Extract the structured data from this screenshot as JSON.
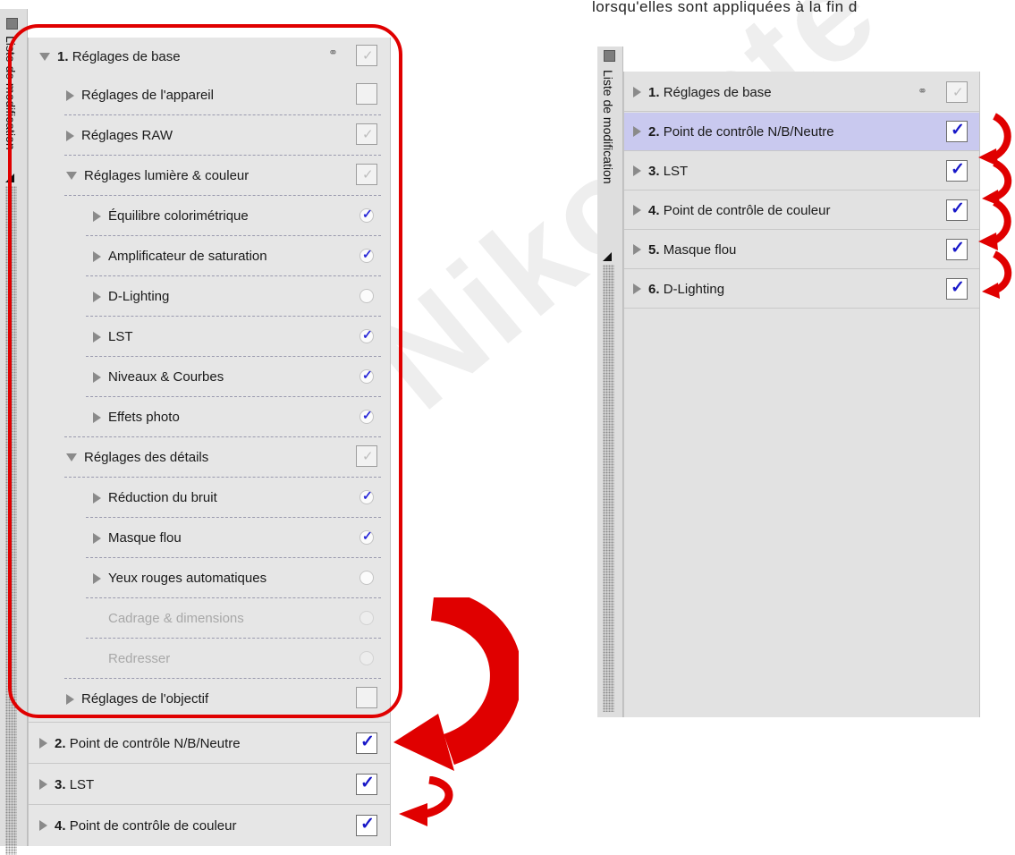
{
  "top_text": "lorsqu'elles  sont  appliquées  à  la  fin  d",
  "watermark": "Nikoliste",
  "left_panel": {
    "side_label": "Liste de modification",
    "header": {
      "number": "1.",
      "label": "Réglages de base"
    },
    "items": [
      {
        "label": "Réglages de l'appareil",
        "indent": 1,
        "expanded": false,
        "control": "checkbox-empty"
      },
      {
        "label": "Réglages RAW",
        "indent": 1,
        "expanded": false,
        "control": "checkbox-grey"
      },
      {
        "label": "Réglages lumière & couleur",
        "indent": 1,
        "expanded": true,
        "control": "checkbox-grey"
      },
      {
        "label": "Équilibre colorimétrique",
        "indent": 2,
        "expanded": false,
        "control": "radio-checked"
      },
      {
        "label": "Amplificateur de saturation",
        "indent": 2,
        "expanded": false,
        "control": "radio-checked"
      },
      {
        "label": "D-Lighting",
        "indent": 2,
        "expanded": false,
        "control": "radio-empty"
      },
      {
        "label": "LST",
        "indent": 2,
        "expanded": false,
        "control": "radio-checked"
      },
      {
        "label": "Niveaux & Courbes",
        "indent": 2,
        "expanded": false,
        "control": "radio-checked"
      },
      {
        "label": "Effets photo",
        "indent": 2,
        "expanded": false,
        "control": "radio-checked"
      },
      {
        "label": "Réglages des détails",
        "indent": 1,
        "expanded": true,
        "control": "checkbox-grey"
      },
      {
        "label": "Réduction du bruit",
        "indent": 2,
        "expanded": false,
        "control": "radio-checked"
      },
      {
        "label": "Masque flou",
        "indent": 2,
        "expanded": false,
        "control": "radio-checked"
      },
      {
        "label": "Yeux rouges automatiques",
        "indent": 2,
        "expanded": false,
        "control": "radio-empty"
      },
      {
        "label": "Cadrage & dimensions",
        "indent": 2,
        "disabled": true,
        "control": "radio-dim"
      },
      {
        "label": "Redresser",
        "indent": 2,
        "disabled": true,
        "control": "radio-dim"
      },
      {
        "label": "Réglages de l'objectif",
        "indent": 1,
        "expanded": false,
        "control": "checkbox-empty"
      }
    ],
    "steps": [
      {
        "number": "2.",
        "label": "Point de contrôle N/B/Neutre"
      },
      {
        "number": "3.",
        "label": "LST"
      },
      {
        "number": "4.",
        "label": "Point de contrôle de couleur"
      }
    ]
  },
  "right_panel": {
    "side_label": "Liste de modification",
    "steps": [
      {
        "number": "1.",
        "label": "Réglages de base",
        "control": "checkbox-grey",
        "link": true
      },
      {
        "number": "2.",
        "label": "Point de contrôle N/B/Neutre",
        "control": "checkbox-blue",
        "selected": true
      },
      {
        "number": "3.",
        "label": "LST",
        "control": "checkbox-blue"
      },
      {
        "number": "4.",
        "label": "Point de contrôle de couleur",
        "control": "checkbox-blue"
      },
      {
        "number": "5.",
        "label": "Masque flou",
        "control": "checkbox-blue"
      },
      {
        "number": "6.",
        "label": "D-Lighting",
        "control": "checkbox-blue"
      }
    ]
  },
  "colors": {
    "annotation_red": "#e00000",
    "check_blue": "#1818c8",
    "selected_row": "#c9c9ef"
  },
  "icons": {
    "checkmark": "✓",
    "expand": "expand-triangle-icon",
    "link": "link-icon"
  }
}
